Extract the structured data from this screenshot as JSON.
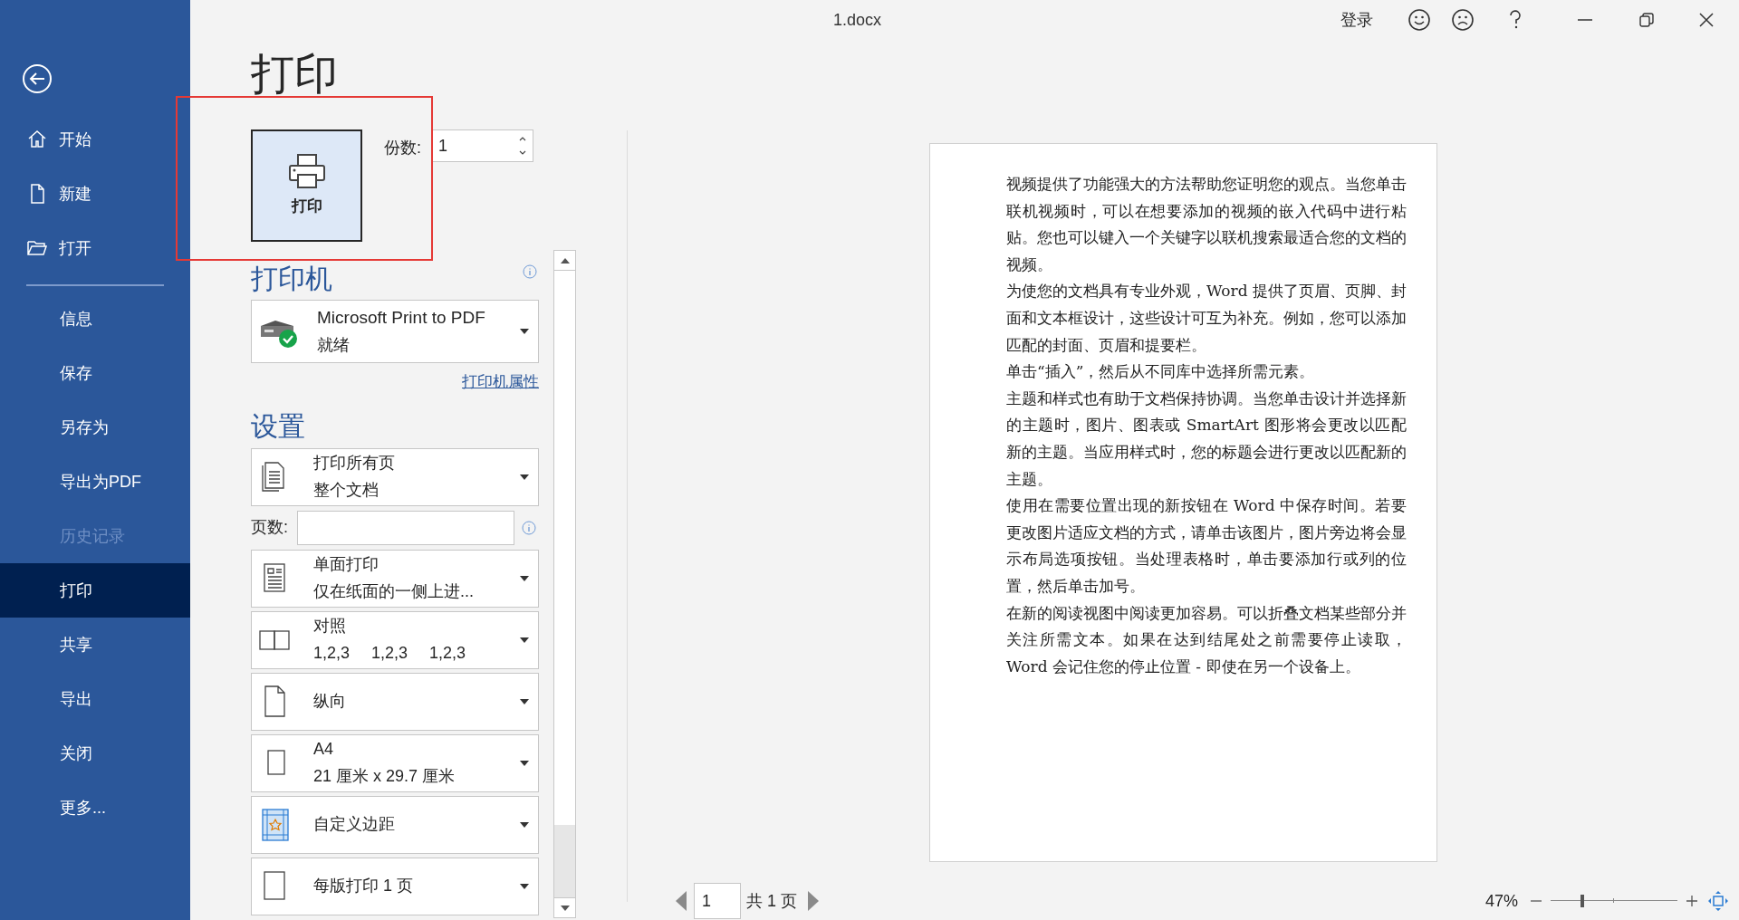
{
  "window": {
    "title": "1.docx",
    "sign_in": "登录"
  },
  "nav": {
    "top_items": [
      {
        "label": "开始",
        "kind": "home"
      },
      {
        "label": "新建",
        "kind": "new"
      },
      {
        "label": "打开",
        "kind": "open"
      }
    ],
    "items": [
      {
        "label": "信息",
        "selected": false,
        "disabled": false
      },
      {
        "label": "保存",
        "selected": false,
        "disabled": false
      },
      {
        "label": "另存为",
        "selected": false,
        "disabled": false
      },
      {
        "label": "导出为PDF",
        "selected": false,
        "disabled": false
      },
      {
        "label": "历史记录",
        "selected": false,
        "disabled": true
      },
      {
        "label": "打印",
        "selected": true,
        "disabled": false
      },
      {
        "label": "共享",
        "selected": false,
        "disabled": false
      },
      {
        "label": "导出",
        "selected": false,
        "disabled": false
      },
      {
        "label": "关闭",
        "selected": false,
        "disabled": false
      },
      {
        "label": "更多...",
        "selected": false,
        "disabled": false
      }
    ]
  },
  "print": {
    "heading": "打印",
    "print_button": "打印",
    "copies": {
      "label": "份数:",
      "value": "1"
    },
    "printer": {
      "heading": "打印机",
      "name": "Microsoft Print to PDF",
      "status": "就绪",
      "properties_link": "打印机属性"
    },
    "settings": {
      "heading": "设置",
      "items": [
        {
          "kind": "pages",
          "title": "打印所有页",
          "subtitle": "整个文档"
        },
        {
          "kind": "range",
          "label": "页数:"
        },
        {
          "kind": "sides",
          "title": "单面打印",
          "subtitle": "仅在纸面的一侧上进..."
        },
        {
          "kind": "collate",
          "title": "对照",
          "sequences": [
            "1,2,3",
            "1,2,3",
            "1,2,3"
          ]
        },
        {
          "kind": "orientation",
          "title": "纵向"
        },
        {
          "kind": "paper",
          "title": "A4",
          "subtitle": "21 厘米 x 29.7 厘米"
        },
        {
          "kind": "margins",
          "title": "自定义边距"
        },
        {
          "kind": "persheet",
          "title": "每版打印 1 页"
        }
      ]
    }
  },
  "preview": {
    "paragraphs": [
      "视频提供了功能强大的方法帮助您证明您的观点。当您单击联机视频时，可以在想要添加的视频的嵌入代码中进行粘贴。您也可以键入一个关键字以联机搜索最适合您的文档的视频。",
      "为使您的文档具有专业外观，Word 提供了页眉、页脚、封面和文本框设计，这些设计可互为补充。例如，您可以添加匹配的封面、页眉和提要栏。",
      "单击“插入”，然后从不同库中选择所需元素。",
      "主题和样式也有助于文档保持协调。当您单击设计并选择新的主题时，图片、图表或 SmartArt 图形将会更改以匹配新的主题。当应用样式时，您的标题会进行更改以匹配新的主题。",
      "使用在需要位置出现的新按钮在 Word 中保存时间。若要更改图片适应文档的方式，请单击该图片，图片旁边将会显示布局选项按钮。当处理表格时，单击要添加行或列的位置，然后单击加号。",
      "在新的阅读视图中阅读更加容易。可以折叠文档某些部分并关注所需文本。如果在达到结尾处之前需要停止读取，Word 会记住您的停止位置 - 即使在另一个设备上。"
    ],
    "page_nav": {
      "current": "1",
      "total": "共 1 页"
    },
    "zoom": {
      "reading": "47%",
      "level": 0.24
    }
  }
}
